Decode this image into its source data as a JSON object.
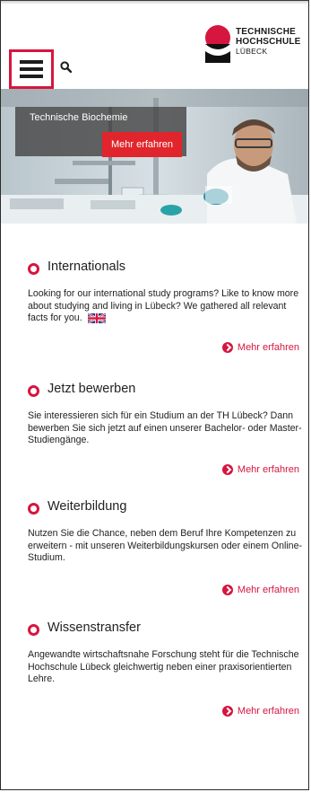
{
  "header": {
    "logo_line1": "TECHNISCHE",
    "logo_line2": "HOCHSCHULE",
    "logo_line3": "LÜBECK",
    "menu_icon": "hamburger-menu-icon",
    "search_icon": "search-icon"
  },
  "hero": {
    "caption": "Technische Biochemie",
    "button_label": "Mehr erfahren"
  },
  "sections": [
    {
      "title": "Internationals",
      "text": "Looking for our international study programs? Like to know more about studying and living in Lübeck? We gathered all relevant facts for you.",
      "link": "Mehr erfahren",
      "flag_icon": "uk-flag-icon"
    },
    {
      "title": "Jetzt bewerben",
      "text": "Sie interessieren sich für ein Studium an der TH Lübeck? Dann bewerben Sie sich jetzt auf einen unserer Bachelor- oder Master-Studiengänge.",
      "link": "Mehr erfahren"
    },
    {
      "title": "Weiterbildung",
      "text": "Nutzen Sie die Chance, neben dem Beruf Ihre Kompetenzen zu erweitern - mit unseren Weiterbildungskursen oder einem Online-Studium.",
      "link": "Mehr erfahren"
    },
    {
      "title": "Wissenstransfer",
      "text": "Angewandte wirtschaftsnahe Forschung steht für die Technische Hochschule Lübeck gleichwertig neben einer praxisorientierten Lehre.",
      "link": "Mehr erfahren"
    }
  ],
  "colors": {
    "accent": "#d6163f",
    "button": "#e0262c"
  }
}
